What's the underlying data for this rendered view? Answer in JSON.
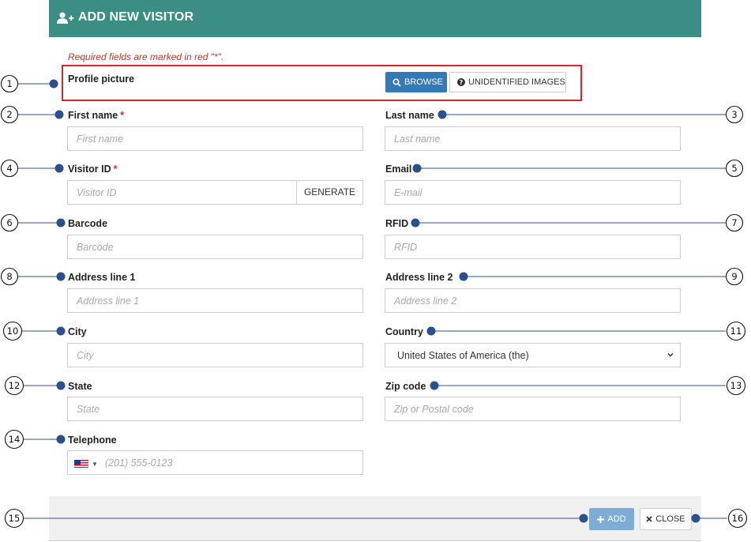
{
  "header": {
    "title": "ADD NEW VISITOR",
    "icon": "user-plus-icon",
    "color": "#3a8e84"
  },
  "required_note": "Required fields are marked in red \"*\".",
  "profile": {
    "label": "Profile picture",
    "browse_label": "BROWSE",
    "unidentified_label": "UNIDENTIFIED IMAGES"
  },
  "fields": {
    "first_name": {
      "label": "First name",
      "required": "*",
      "placeholder": "First name"
    },
    "last_name": {
      "label": "Last name",
      "placeholder": "Last name"
    },
    "visitor_id": {
      "label": "Visitor ID",
      "required": "*",
      "placeholder": "Visitor ID",
      "button": "GENERATE"
    },
    "email": {
      "label": "Email",
      "placeholder": "E-mail"
    },
    "barcode": {
      "label": "Barcode",
      "placeholder": "Barcode"
    },
    "rfid": {
      "label": "RFID",
      "placeholder": "RFID"
    },
    "address1": {
      "label": "Address line 1",
      "placeholder": "Address line 1"
    },
    "address2": {
      "label": "Address line 2",
      "placeholder": "Address line 2"
    },
    "city": {
      "label": "City",
      "placeholder": "City"
    },
    "country": {
      "label": "Country",
      "value": "United States of America (the)"
    },
    "state": {
      "label": "State",
      "placeholder": "State"
    },
    "zip": {
      "label": "Zip code",
      "placeholder": "Zip or Postal code"
    },
    "telephone": {
      "label": "Telephone",
      "placeholder": "(201) 555-0123",
      "flag": "us-flag-icon"
    }
  },
  "footer": {
    "add_label": "ADD",
    "close_label": "CLOSE"
  },
  "callouts": {
    "c1": "1",
    "c2": "2",
    "c3": "3",
    "c4": "4",
    "c5": "5",
    "c6": "6",
    "c7": "7",
    "c8": "8",
    "c9": "9",
    "c10": "10",
    "c11": "11",
    "c12": "12",
    "c13": "13",
    "c14": "14",
    "c15": "15",
    "c16": "16"
  },
  "colors": {
    "accent": "#337ab7",
    "callout_dot": "#2c4f8f",
    "highlight": "#d9232d",
    "required": "#d9232d"
  }
}
